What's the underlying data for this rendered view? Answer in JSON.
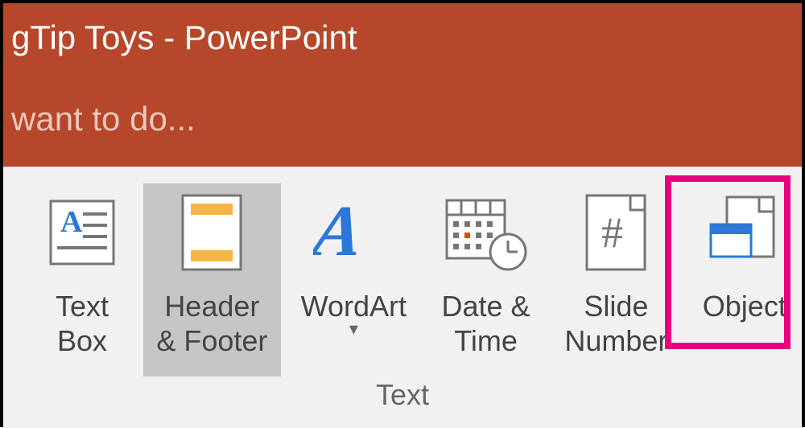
{
  "titlebar": {
    "text": "gTip Toys - PowerPoint"
  },
  "tellme": {
    "text": "want to do..."
  },
  "group": {
    "label": "Text"
  },
  "buttons": {
    "textbox": {
      "label": "Text\nBox"
    },
    "headerfooter": {
      "label": "Header\n& Footer"
    },
    "wordart": {
      "label": "WordArt"
    },
    "datetime": {
      "label": "Date &\nTime"
    },
    "slidenumber": {
      "label": "Slide\nNumber"
    },
    "object": {
      "label": "Object"
    }
  }
}
